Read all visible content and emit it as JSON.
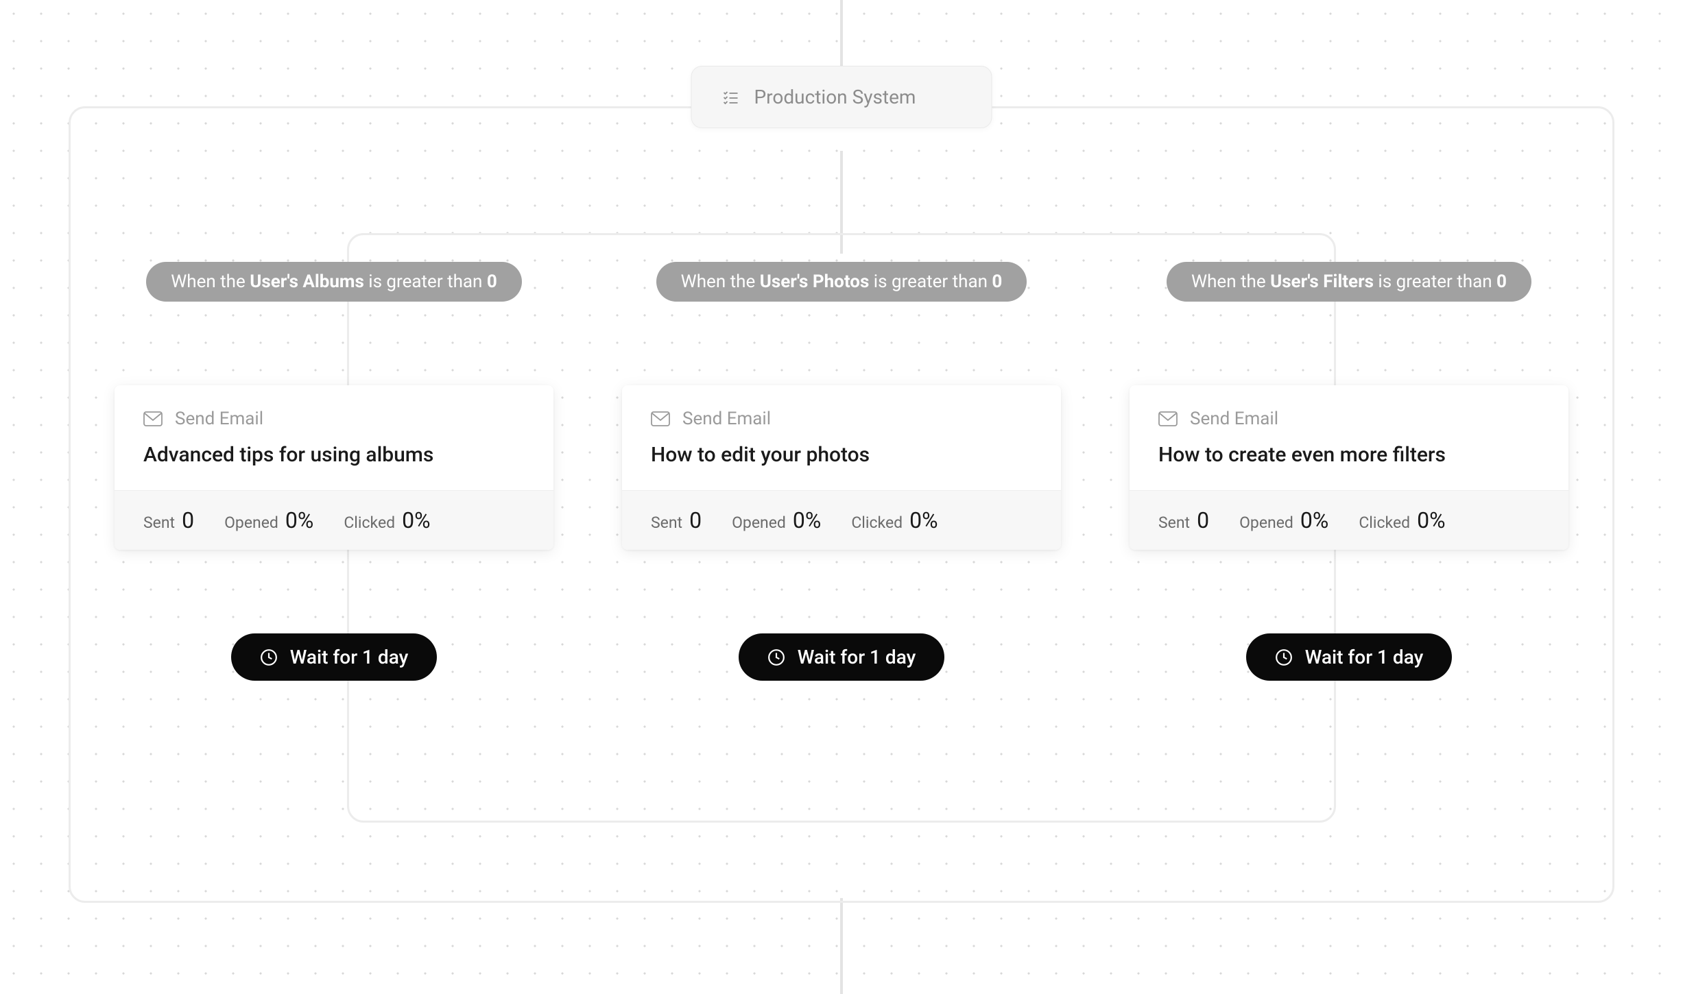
{
  "system": {
    "label": "Production System"
  },
  "branches": [
    {
      "condition": {
        "prefix": "When the ",
        "property": "User's Albums",
        "operator": " is greater than ",
        "value": "0"
      },
      "card": {
        "action": "Send Email",
        "title": "Advanced tips for using albums",
        "stats": {
          "sent_label": "Sent",
          "sent": "0",
          "opened_label": "Opened",
          "opened": "0%",
          "clicked_label": "Clicked",
          "clicked": "0%"
        }
      },
      "wait": {
        "label": "Wait for 1 day"
      }
    },
    {
      "condition": {
        "prefix": "When the ",
        "property": "User's Photos",
        "operator": " is greater than ",
        "value": "0"
      },
      "card": {
        "action": "Send Email",
        "title": "How to edit your photos",
        "stats": {
          "sent_label": "Sent",
          "sent": "0",
          "opened_label": "Opened",
          "opened": "0%",
          "clicked_label": "Clicked",
          "clicked": "0%"
        }
      },
      "wait": {
        "label": "Wait for 1 day"
      }
    },
    {
      "condition": {
        "prefix": "When the ",
        "property": "User's Filters",
        "operator": " is greater than ",
        "value": "0"
      },
      "card": {
        "action": "Send Email",
        "title": "How to create even more filters",
        "stats": {
          "sent_label": "Sent",
          "sent": "0",
          "opened_label": "Opened",
          "opened": "0%",
          "clicked_label": "Clicked",
          "clicked": "0%"
        }
      },
      "wait": {
        "label": "Wait for 1 day"
      }
    }
  ]
}
